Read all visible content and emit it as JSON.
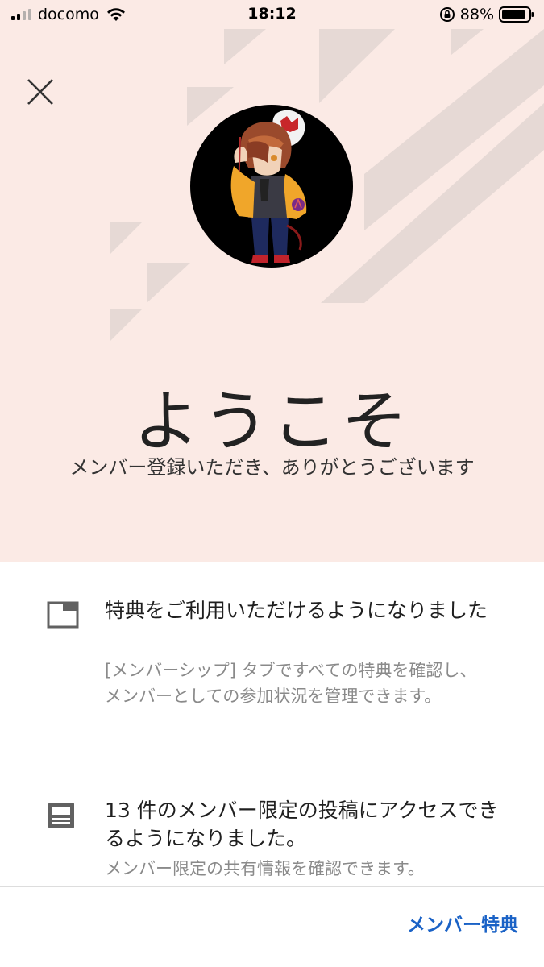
{
  "status_bar": {
    "carrier": "docomo",
    "time": "18:12",
    "battery": "88%",
    "battery_level": 0.88,
    "signal_bars": 2
  },
  "welcome": {
    "title": "ようこそ",
    "subtitle": "メンバー登録いただき、ありがとうございます"
  },
  "benefits": [
    {
      "icon": "tab-window-icon",
      "title": "特典をご利用いただけるようになりました",
      "description": "[メンバーシップ] タブですべての特典を確認し、メンバーとしての参加状況を管理できます。"
    },
    {
      "icon": "posts-list-icon",
      "title": "13 件のメンバー限定の投稿にアクセスできるようになりました。",
      "description": "メンバー限定の共有情報を確認できます。"
    }
  ],
  "footer": {
    "button_label": "メンバー特典"
  },
  "colors": {
    "hero_background": "#fbeae5",
    "accent": "#1a62c6"
  }
}
